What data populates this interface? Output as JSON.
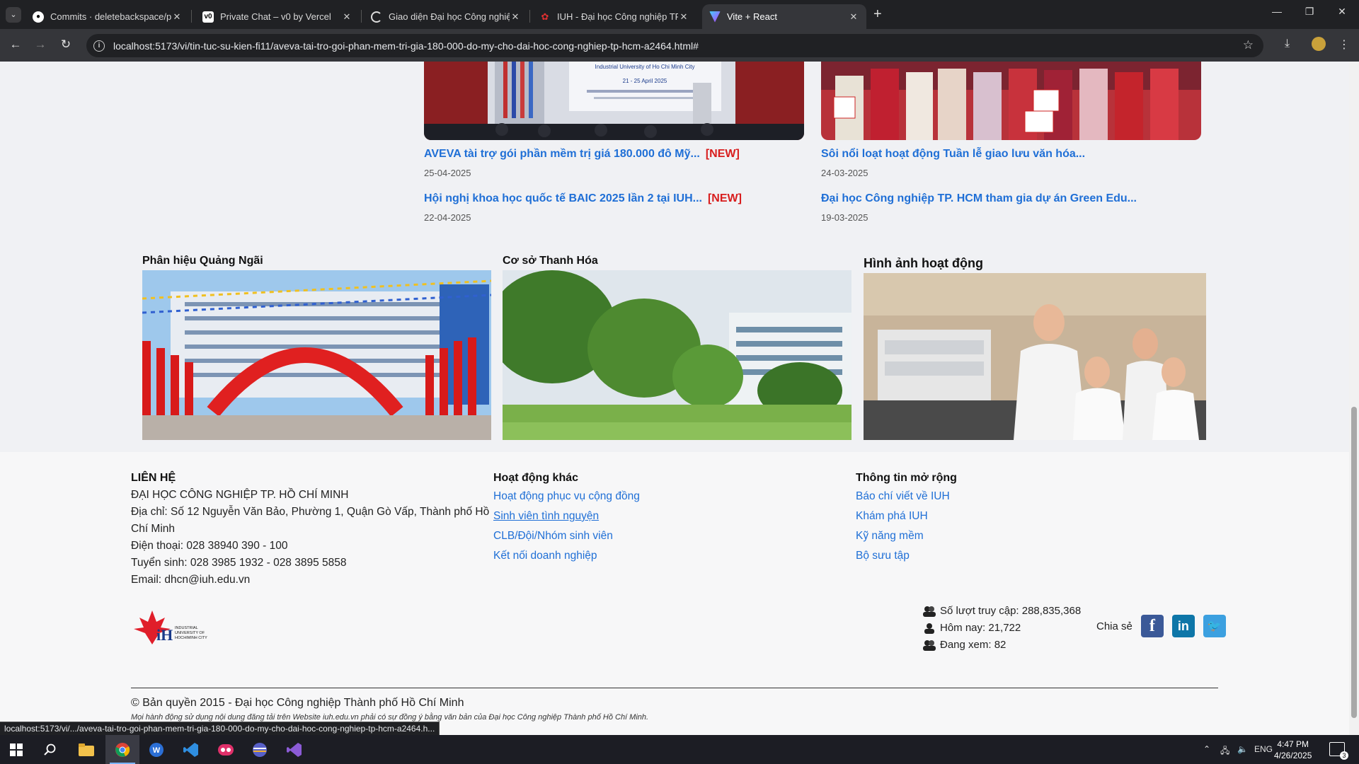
{
  "browser": {
    "tabs": [
      {
        "title": "Commits · deletebackspace/ph",
        "icon": "github-icon"
      },
      {
        "title": "Private Chat – v0 by Vercel",
        "icon": "v0-icon"
      },
      {
        "title": "Giao diện Đại học Công nghiệp",
        "icon": "loading-icon"
      },
      {
        "title": "IUH - Đại học Công nghiệp TP.H",
        "icon": "iuh-icon"
      },
      {
        "title": "Vite + React",
        "icon": "vite-icon"
      }
    ],
    "url": "localhost:5173/vi/tin-tuc-su-kien-fi11/aveva-tai-tro-goi-phan-mem-tri-gia-180-000-do-my-cho-dai-hoc-cong-nghiep-tp-hcm-a2464.html#",
    "status_url": "localhost:5173/vi/.../aveva-tai-tro-goi-phan-mem-tri-gia-180-000-do-my-cho-dai-hoc-cong-nghiep-tp-hcm-a2464.h..."
  },
  "news": {
    "left": [
      {
        "title": "AVEVA tài trợ gói phần mềm trị giá 180.000 đô Mỹ...",
        "badge": "[NEW]",
        "date": "25-04-2025"
      },
      {
        "title": "Hội nghị khoa học quốc tế BAIC 2025 lần 2 tại IUH...",
        "badge": "[NEW]",
        "date": "22-04-2025"
      }
    ],
    "right": [
      {
        "title": "Sôi nổi loạt hoạt động Tuần lễ giao lưu văn hóa...",
        "date": "24-03-2025"
      },
      {
        "title": "Đại học Công nghiệp TP. HCM tham gia dự án Green Edu...",
        "date": "19-03-2025"
      }
    ],
    "banner_text_1": "Industrial University of Ho Chi Minh City",
    "banner_text_2": "21 - 25 April 2025"
  },
  "campuses": [
    {
      "title": "Phân hiệu Quảng Ngãi"
    },
    {
      "title": "Cơ sở Thanh Hóa"
    },
    {
      "title": "Hình ảnh hoạt động"
    }
  ],
  "footer": {
    "contact": {
      "heading": "LIÊN HỆ",
      "org": "ĐẠI HỌC CÔNG NGHIỆP TP. HỒ CHÍ MINH",
      "address_1": "Địa chỉ: Số 12 Nguyễn Văn Bảo, Phường 1, Quận Gò Vấp, Thành phố Hồ",
      "address_2": "Chí Minh",
      "phone": "Điện thoại: 028 38940 390 - 100",
      "admission": "Tuyển sinh: 028 3985 1932 - 028 3895 5858",
      "email": "Email: dhcn@iuh.edu.vn"
    },
    "activities": {
      "heading": "Hoạt động khác",
      "links": [
        "Hoạt động phục vụ cộng đồng",
        "Sinh viên tình nguyện",
        "CLB/Đội/Nhóm sinh viên",
        "Kết nối doanh nghiệp"
      ]
    },
    "extended": {
      "heading": "Thông tin mở rộng",
      "links": [
        "Báo chí viết về IUH",
        "Khám phá IUH",
        "Kỹ năng mềm",
        "Bộ sưu tập"
      ]
    },
    "logo": {
      "mark": "iH",
      "line1": "INDUSTRIAL",
      "line2": "UNIVERSITY OF",
      "line3": "HOCHIMINH CITY"
    },
    "stats": {
      "visits": "Số lượt truy cập: 288,835,368",
      "today": "Hôm nay: 21,722",
      "online": "Đang xem: 82"
    },
    "share_label": "Chia sẻ",
    "copyright": "© Bản quyền 2015 - Đại học Công nghiệp Thành phố Hồ Chí Minh",
    "note": "Mọi hành động sử dụng nội dung đăng tải trên Website iuh.edu.vn phải có sự đồng ý bằng văn bản của Đại học Công nghiệp Thành phố Hồ Chí Minh."
  },
  "taskbar": {
    "lang": "ENG",
    "time": "4:47 PM",
    "date": "4/26/2025",
    "notifications": "3"
  }
}
